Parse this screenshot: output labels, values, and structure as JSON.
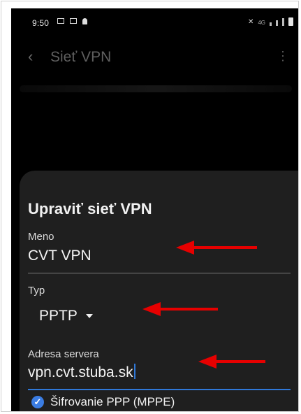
{
  "status_bar": {
    "time": "9:50",
    "network_label": "4G"
  },
  "app_bar": {
    "title": "Sieť VPN"
  },
  "dialog": {
    "title": "Upraviť sieť VPN",
    "fields": {
      "name": {
        "label": "Meno",
        "value": "CVT VPN"
      },
      "type": {
        "label": "Typ",
        "value": "PPTP"
      },
      "server": {
        "label": "Adresa servera",
        "value": "vpn.cvt.stuba.sk"
      }
    },
    "encryption": {
      "label": "Šifrovanie PPP (MPPE)",
      "checked": true
    }
  },
  "colors": {
    "dialog_bg": "#1f1f1f",
    "accent": "#2f78d8",
    "annotation_arrow": "#e60000"
  }
}
